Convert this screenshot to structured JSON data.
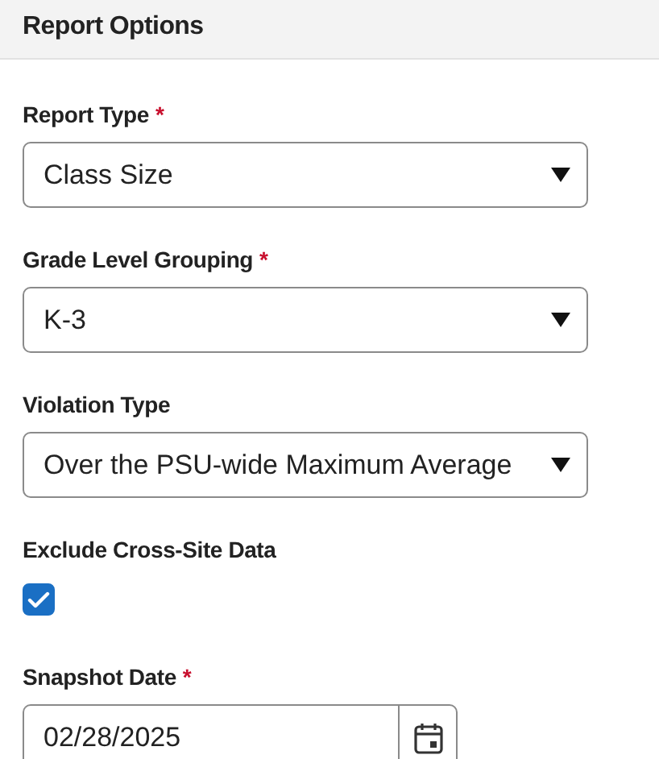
{
  "panel": {
    "title": "Report Options"
  },
  "fields": [
    {
      "kind": "select",
      "label": "Report Type",
      "required_mark": "*",
      "value": "Class Size"
    },
    {
      "kind": "select",
      "label": "Grade Level Grouping",
      "required_mark": "*",
      "value": "K-3"
    },
    {
      "kind": "select",
      "label": "Violation Type",
      "value": "Over the PSU-wide Maximum Average"
    },
    {
      "kind": "checkbox",
      "label": "Exclude Cross-Site Data",
      "checked": true
    },
    {
      "kind": "date",
      "label": "Snapshot Date",
      "required_mark": "*",
      "value": "02/28/2025"
    }
  ]
}
